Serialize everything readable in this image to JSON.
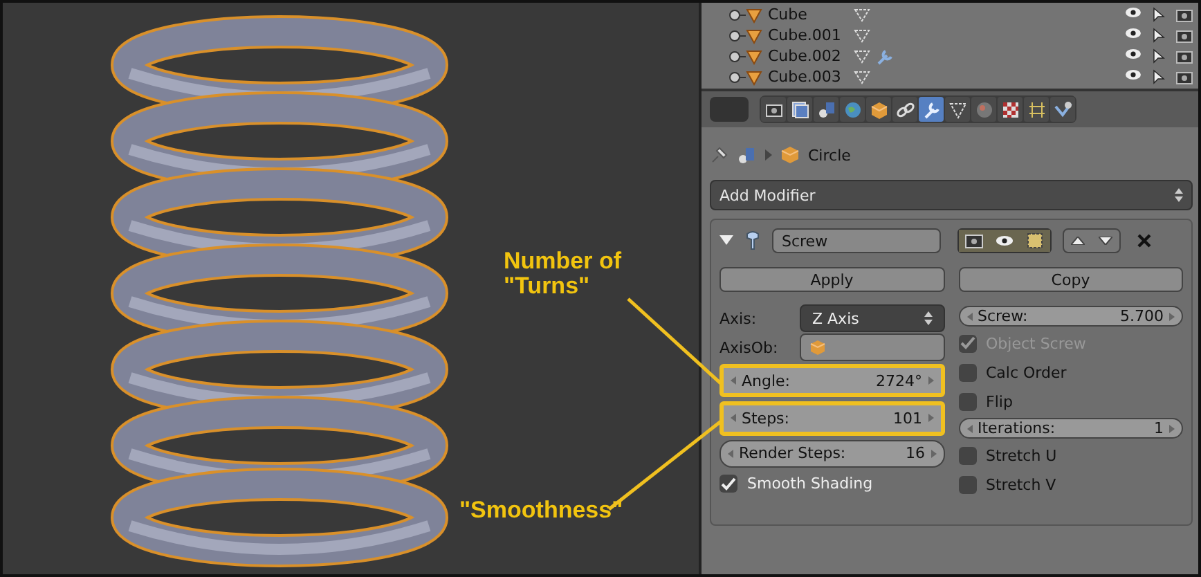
{
  "viewport": {
    "annotations": [
      {
        "text": "Number of \"Turns\"",
        "kind": "turns"
      },
      {
        "text": "\"Smoothness\"",
        "kind": "smoothness"
      }
    ]
  },
  "outliner": {
    "rows": [
      {
        "name": "Cube",
        "icons": [
          {
            "kind": "mesh"
          }
        ]
      },
      {
        "name": "Cube.001",
        "icons": [
          {
            "kind": "mesh"
          }
        ]
      },
      {
        "name": "Cube.002",
        "icons": [
          {
            "kind": "mesh"
          },
          {
            "kind": "modifier"
          }
        ]
      },
      {
        "name": "Cube.003",
        "icons": [
          {
            "kind": "mesh"
          }
        ]
      }
    ]
  },
  "properties_tabs": [
    {
      "kind": "render",
      "selected": false
    },
    {
      "kind": "layers",
      "selected": false
    },
    {
      "kind": "scene",
      "selected": false
    },
    {
      "kind": "world",
      "selected": false
    },
    {
      "kind": "object",
      "selected": false
    },
    {
      "kind": "constraints",
      "selected": false
    },
    {
      "kind": "modifiers",
      "selected": true
    },
    {
      "kind": "data",
      "selected": false
    },
    {
      "kind": "material",
      "selected": false
    },
    {
      "kind": "texture",
      "selected": false
    },
    {
      "kind": "particles",
      "selected": false
    },
    {
      "kind": "physics",
      "selected": false
    }
  ],
  "breadcrumb": {
    "object": "Circle"
  },
  "add_modifier": {
    "label": "Add Modifier"
  },
  "modifier": {
    "name": "Screw",
    "expanded": true,
    "show_render": true,
    "show_viewport": true,
    "show_cage": true,
    "buttons": [
      "Apply",
      "Copy"
    ],
    "left": [
      {
        "kind": "dropdown",
        "label": "Axis:",
        "value": "Z Axis"
      },
      {
        "kind": "object",
        "label": "AxisOb:"
      },
      {
        "kind": "number",
        "label": "Angle:",
        "value": "2724°",
        "highlighted": true
      },
      {
        "kind": "number",
        "label": "Steps:",
        "value": "101",
        "highlighted": true
      },
      {
        "kind": "number",
        "label": "Render Steps:",
        "value": "16",
        "highlighted": false
      },
      {
        "kind": "checkbox",
        "label": "Smooth Shading",
        "checked": true,
        "disabled": false
      }
    ],
    "right": [
      {
        "kind": "number",
        "label": "Screw:",
        "value": "5.700",
        "highlighted": false
      },
      {
        "kind": "checkbox",
        "label": "Object Screw",
        "checked": true,
        "disabled": true
      },
      {
        "kind": "checkbox",
        "label": "Calc Order",
        "checked": false,
        "disabled": false
      },
      {
        "kind": "checkbox",
        "label": "Flip",
        "checked": false,
        "disabled": false
      },
      {
        "kind": "number",
        "label": "Iterations:",
        "value": "1",
        "highlighted": false
      },
      {
        "kind": "checkbox",
        "label": "Stretch U",
        "checked": false,
        "disabled": false
      },
      {
        "kind": "checkbox",
        "label": "Stretch V",
        "checked": false,
        "disabled": false
      }
    ]
  }
}
